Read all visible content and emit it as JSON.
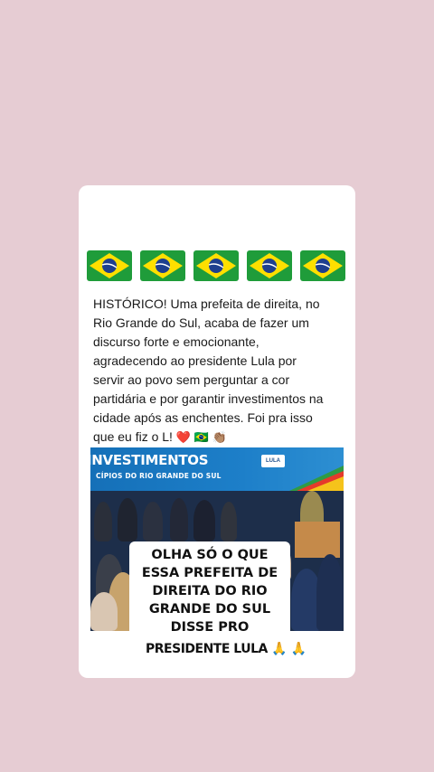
{
  "header": {
    "flags": [
      "brazil-flag",
      "brazil-flag",
      "brazil-flag",
      "brazil-flag",
      "brazil-flag"
    ],
    "colors": {
      "green": "#1f9c3a",
      "yellow": "#fedf00",
      "blue": "#1e3f8f"
    }
  },
  "post": {
    "lines": [
      "HISTÓRICO! Uma prefeita de direita, no",
      "Rio Grande do Sul, acaba de fazer um",
      "discurso forte e emocionante,",
      "agradecendo ao presidente Lula por",
      "servir ao povo sem perguntar a cor",
      "partidária e por garantir investimentos na",
      "cidade após as enchentes. Foi pra isso",
      "que eu fiz o L!"
    ],
    "emojis": "❤️ 🇧🇷 👏🏽"
  },
  "media": {
    "banner_title": "INVESTIMENTOS",
    "banner_subtitle": "CÍPIOS DO RIO GRANDE DO SUL",
    "logo_text": "LULA",
    "caption_lines": [
      "OLHA SÓ O QUE",
      "ESSA PREFEITA DE",
      "DIREITA DO RIO",
      "GRANDE DO SUL",
      "DISSE PRO"
    ],
    "caption_tail": "PRESIDENTE LULA",
    "caption_tail_emojis": "🙏 🙏"
  }
}
